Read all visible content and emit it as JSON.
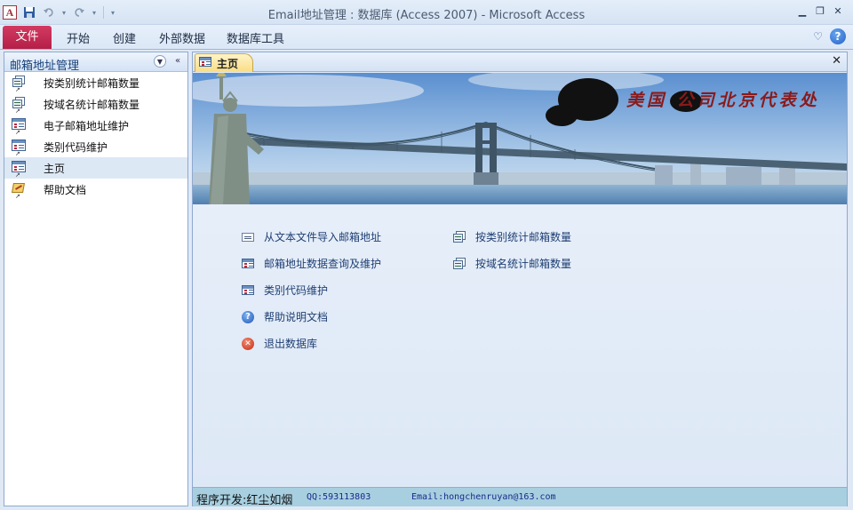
{
  "window": {
    "title": "Email地址管理 : 数据库 (Access 2007)  -  Microsoft Access",
    "logo_letter": "A",
    "controls": {
      "minimize": "▭",
      "restore": "⧉",
      "close": "✕"
    }
  },
  "ribbon": {
    "file_tab": "文件",
    "tabs": [
      "开始",
      "创建",
      "外部数据",
      "数据库工具"
    ]
  },
  "nav": {
    "title": "邮箱地址管理",
    "items": [
      {
        "label": "按类别统计邮箱数量",
        "icon": "report-icon"
      },
      {
        "label": "按域名统计邮箱数量",
        "icon": "report-icon"
      },
      {
        "label": "电子邮箱地址维护",
        "icon": "form-icon"
      },
      {
        "label": "类别代码维护",
        "icon": "form-icon"
      },
      {
        "label": "主页",
        "icon": "form-icon",
        "selected": true
      },
      {
        "label": "帮助文档",
        "icon": "macro-icon"
      }
    ]
  },
  "doc": {
    "tab_label": "主页",
    "banner_text": "美国     公司北京代表处",
    "links": [
      {
        "label": "从文本文件导入邮箱地址",
        "icon": "text-import-icon"
      },
      {
        "label": "邮箱地址数据查询及维护",
        "icon": "form-icon"
      },
      {
        "label": "类别代码维护",
        "icon": "form-icon"
      },
      {
        "label": "帮助说明文档",
        "icon": "help-icon"
      },
      {
        "label": "退出数据库",
        "icon": "exit-icon"
      },
      {
        "label": "按类别统计邮箱数量",
        "icon": "report-icon"
      },
      {
        "label": "按域名统计邮箱数量",
        "icon": "report-icon"
      }
    ],
    "status": {
      "developer": "程序开发:红尘如烟",
      "qq": "QQ:593113803",
      "email": "Email:hongchenruyan@163.com"
    }
  }
}
